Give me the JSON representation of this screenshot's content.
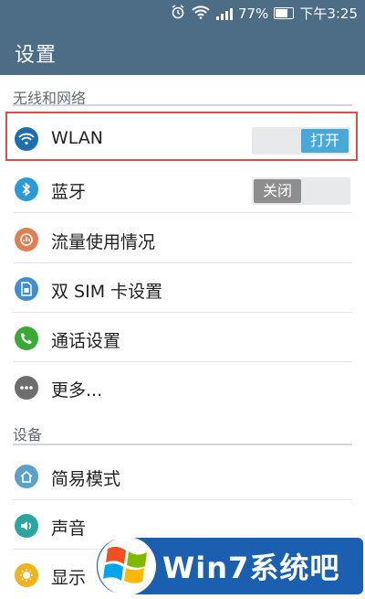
{
  "status_bar": {
    "battery": "77%",
    "time": "下午3:25",
    "icons": [
      "alarm-icon",
      "wifi-icon",
      "signal-icon",
      "battery-icon"
    ]
  },
  "action_bar": {
    "title": "设置"
  },
  "sections": {
    "network": "无线和网络",
    "device": "设备"
  },
  "items": {
    "wlan": {
      "label": "WLAN",
      "toggle": "打开",
      "icon": "wifi-icon",
      "color": "#1e6fb0"
    },
    "bluetooth": {
      "label": "蓝牙",
      "toggle": "关闭",
      "icon": "bluetooth-icon",
      "color": "#2b9bd6"
    },
    "data_usage": {
      "label": "流量使用情况",
      "icon": "data-usage-icon",
      "color": "#e07e54"
    },
    "dual_sim": {
      "label": "双 SIM 卡设置",
      "icon": "sim-card-icon",
      "color": "#3f8fd0"
    },
    "call": {
      "label": "通话设置",
      "icon": "phone-icon",
      "color": "#3aaa35"
    },
    "more": {
      "label": "更多...",
      "icon": "more-icon",
      "color": "#6d6d6d"
    },
    "easy_mode": {
      "label": "简易模式",
      "icon": "home-icon",
      "color": "#5aa0c8"
    },
    "sound": {
      "label": "声音",
      "icon": "speaker-icon",
      "color": "#2aa5a0"
    },
    "display": {
      "label": "显示",
      "icon": "brightness-icon",
      "color": "#f2b21e"
    }
  },
  "watermark": {
    "text": "Win7系统吧"
  },
  "colors": {
    "accent": "#4d6c86",
    "highlight": "#d4504c"
  }
}
